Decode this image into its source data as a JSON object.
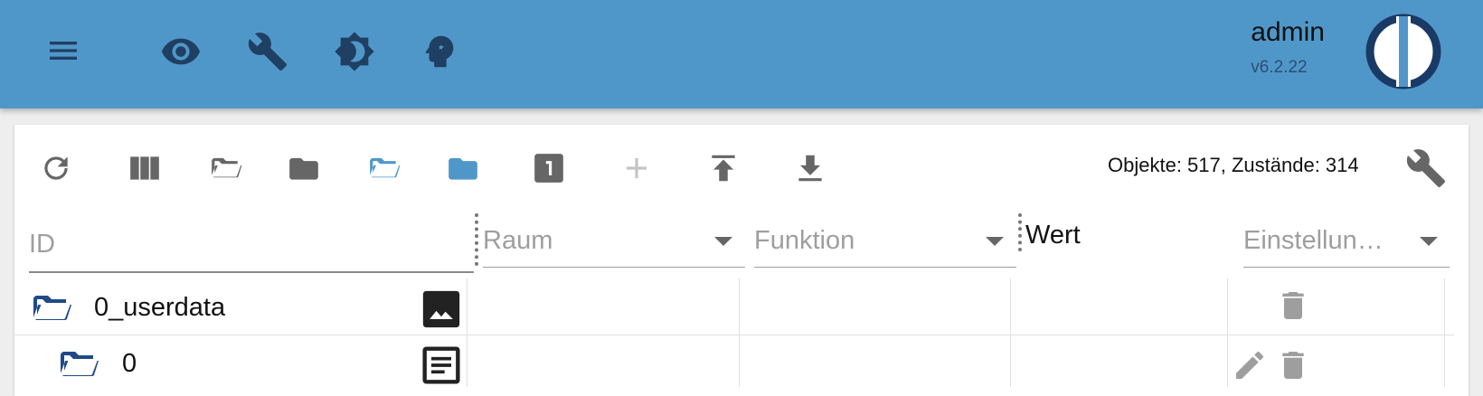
{
  "header": {
    "menu_icon": "menu-icon",
    "tabs": [
      {
        "icon": "eye-icon"
      },
      {
        "icon": "wrench-icon"
      },
      {
        "icon": "brightness-icon"
      },
      {
        "icon": "head-expert-icon"
      }
    ],
    "username": "admin",
    "version": "v6.2.22",
    "colors": {
      "bar": "#5097c9",
      "icon": "#1f3f63"
    }
  },
  "toolbar": {
    "buttons": [
      {
        "icon": "refresh-icon"
      },
      {
        "icon": "columns-icon"
      },
      {
        "icon": "folder-open-icon"
      },
      {
        "icon": "folder-closed-icon"
      },
      {
        "icon": "folder-open-blue-icon"
      },
      {
        "icon": "folder-blue-icon"
      },
      {
        "icon": "number-one-icon"
      },
      {
        "icon": "add-icon"
      },
      {
        "icon": "upload-icon"
      },
      {
        "icon": "download-icon"
      }
    ],
    "stats": "Objekte: 517, Zustände: 314",
    "settings_icon": "wrench-icon"
  },
  "columns": {
    "id_placeholder": "ID",
    "room_placeholder": "Raum",
    "function_placeholder": "Funktion",
    "value_label": "Wert",
    "settings_placeholder": "Einstellun…"
  },
  "rows": [
    {
      "name": "0_userdata",
      "type_icon": "image-icon",
      "actions": [
        "delete-icon"
      ]
    },
    {
      "name": "0",
      "type_icon": "document-icon",
      "actions": [
        "edit-icon",
        "delete-icon"
      ]
    }
  ]
}
